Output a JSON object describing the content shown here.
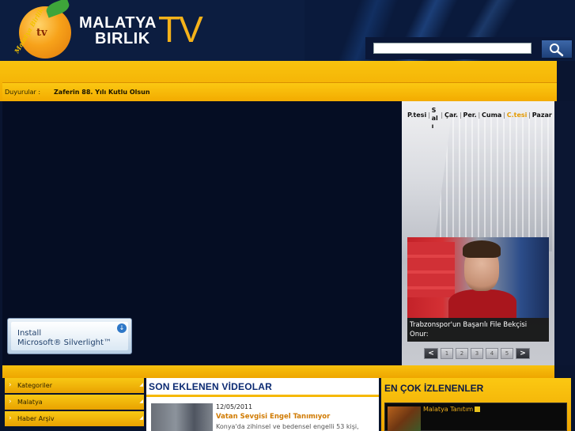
{
  "brand": {
    "logo_arc_text": "Malatya Birlik",
    "logo_badge": "tv",
    "name_line1": "MALATYA",
    "name_line2": "BIRLIK",
    "name_tv": "TV"
  },
  "search": {
    "placeholder": "",
    "button_icon": "search-icon"
  },
  "announcement": {
    "label": "Duyurular :",
    "text": "Zaferin 88. Yılı Kutlu Olsun"
  },
  "player": {
    "silverlight_line1": "Install",
    "silverlight_line2": "Microsoft® Silverlight™"
  },
  "schedule": {
    "days": [
      "P.tesi",
      "Salı",
      "Çar.",
      "Per.",
      "Cuma",
      "C.tesi",
      "Pazar"
    ],
    "active_day": "C.tesi",
    "separator": "|",
    "caption": "Trabzonspor'un Başarılı File Bekçisi Onur:",
    "pager_prev": "<",
    "pager_next": ">",
    "pages": [
      "1",
      "2",
      "3",
      "4",
      "5"
    ]
  },
  "sidebar": {
    "items": [
      {
        "label": "Kategoriler"
      },
      {
        "label": "Malatya"
      },
      {
        "label": "Haber Arşiv"
      }
    ]
  },
  "recent": {
    "title": "SON EKLENEN VİDEOLAR",
    "items": [
      {
        "date": "12/05/2011",
        "title": "Vatan Sevgisi Engel Tanımıyor",
        "description": "Konya'da zihinsel ve bedensel engelli 53 kişi,"
      }
    ]
  },
  "popular": {
    "title": "EN ÇOK İZLENENLER",
    "items": [
      {
        "title": "Malatya Tanıtım"
      }
    ]
  },
  "colors": {
    "accent_yellow": "#f6b800",
    "navy": "#0a1530",
    "link_orange": "#d07a00",
    "title_blue": "#0b2a72"
  }
}
